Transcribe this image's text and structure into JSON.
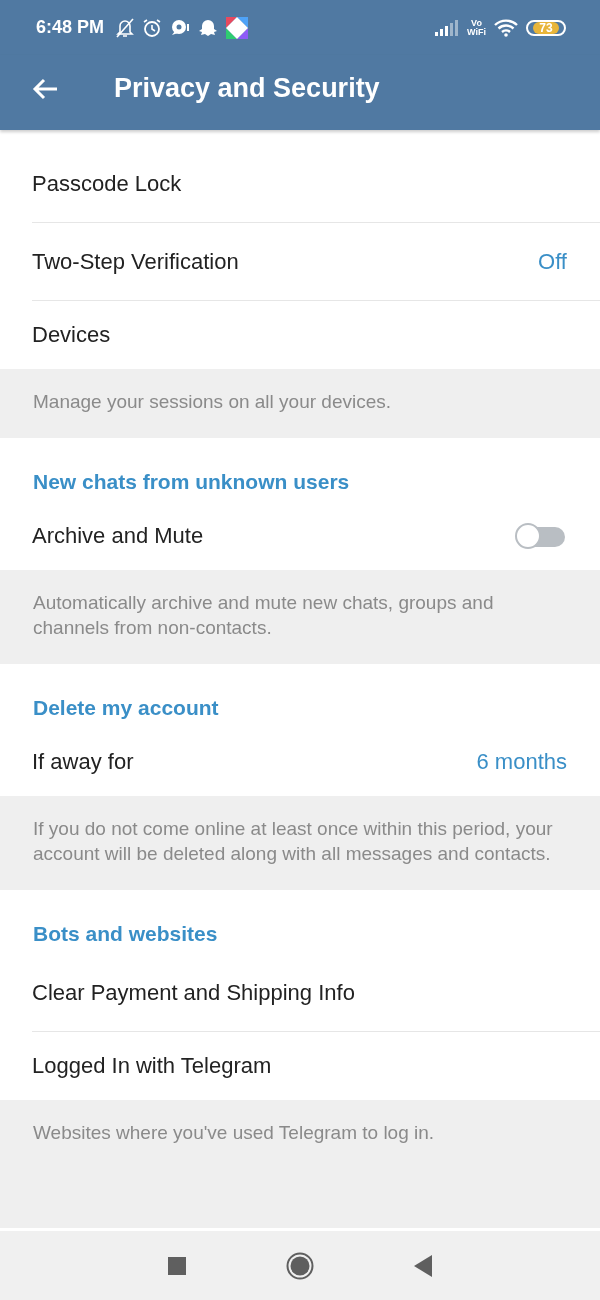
{
  "status_bar": {
    "time": "6:48 PM",
    "vowifi_top": "Vo",
    "vowifi_bottom": "WiFi",
    "battery": "73"
  },
  "app_bar": {
    "title": "Privacy and Security"
  },
  "sections": [
    {
      "rows": [
        {
          "kind": "nav",
          "label": "Passcode Lock"
        },
        {
          "kind": "value",
          "label": "Two-Step Verification",
          "value": "Off"
        },
        {
          "kind": "nav",
          "label": "Devices"
        }
      ],
      "footer": "Manage your sessions on all your devices."
    },
    {
      "header": "New chats from unknown users",
      "rows": [
        {
          "kind": "toggle",
          "label": "Archive and Mute",
          "on": false
        }
      ],
      "footer": "Automatically archive and mute new chats, groups and channels from non-contacts."
    },
    {
      "header": "Delete my account",
      "rows": [
        {
          "kind": "value",
          "label": "If away for",
          "value": "6 months"
        }
      ],
      "footer": "If you do not come online at least once within this period, your account will be deleted along with all messages and contacts."
    },
    {
      "header": "Bots and websites",
      "rows": [
        {
          "kind": "nav",
          "label": "Clear Payment and Shipping Info"
        },
        {
          "kind": "nav",
          "label": "Logged In with Telegram"
        }
      ],
      "footer": "Websites where you've used Telegram to log in."
    }
  ]
}
